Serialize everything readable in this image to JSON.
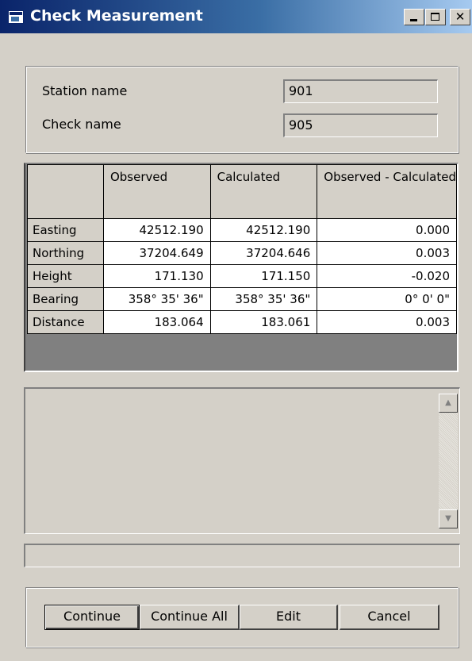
{
  "window": {
    "title": "Check Measurement",
    "minimize_label": "_",
    "close_label": "✕"
  },
  "station": {
    "station_label": "Station name",
    "station_value": "901",
    "check_label": "Check name",
    "check_value": "905"
  },
  "table": {
    "headers": [
      "",
      "Observed",
      "Calculated",
      "Observed - Calculated"
    ],
    "rows": [
      {
        "label": "Easting",
        "observed": "42512.190",
        "calculated": "42512.190",
        "diff": "0.000"
      },
      {
        "label": "Northing",
        "observed": "37204.649",
        "calculated": "37204.646",
        "diff": "0.003"
      },
      {
        "label": "Height",
        "observed": "171.130",
        "calculated": "171.150",
        "diff": "-0.020"
      },
      {
        "label": "Bearing",
        "observed": "358° 35' 36\"",
        "calculated": "358° 35' 36\"",
        "diff": "0°  0'  0\""
      },
      {
        "label": "Distance",
        "observed": "183.064",
        "calculated": "183.061",
        "diff": "0.003"
      }
    ]
  },
  "scroll": {
    "up_arrow": "▲",
    "down_arrow": "▼"
  },
  "buttons": {
    "continue": "Continue",
    "continue_all": "Continue All",
    "edit": "Edit",
    "cancel": "Cancel"
  },
  "colors": {
    "titlebar_start": "#0a246a",
    "titlebar_end": "#a6caf0",
    "face": "#d4d0c8"
  }
}
